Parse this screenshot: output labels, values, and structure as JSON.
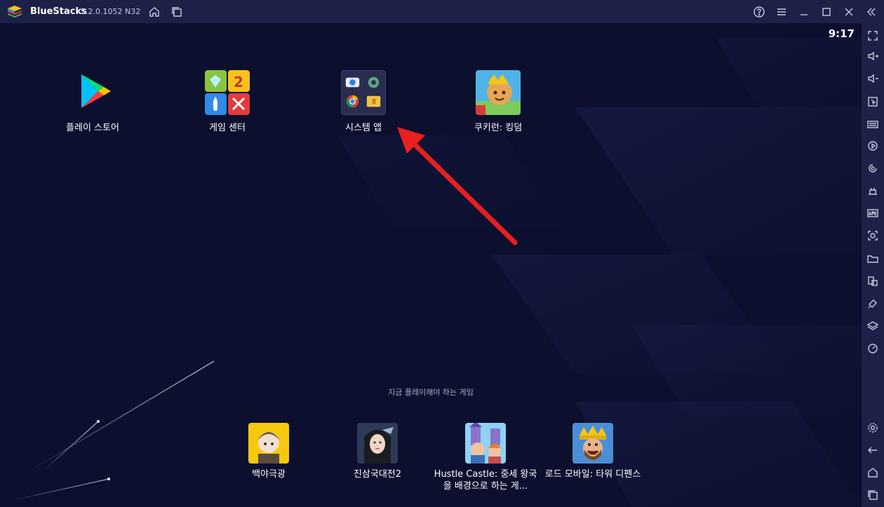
{
  "titlebar": {
    "app_name": "BlueStacks",
    "version": "5.2.0.1052 N32"
  },
  "status": {
    "time": "9:17"
  },
  "home_apps": [
    {
      "label": "플레이 스토어",
      "icon": "play-store-icon"
    },
    {
      "label": "게임 센터",
      "icon": "game-center-icon"
    },
    {
      "label": "시스템 앱",
      "icon": "system-apps-folder-icon"
    },
    {
      "label": "쿠키런: 킹덤",
      "icon": "cookie-run-kingdom-icon"
    }
  ],
  "recommended": {
    "title": "지금 플레이해야 하는 게임",
    "games": [
      {
        "label": "백야극광",
        "icon": "baekyageukgwang-icon"
      },
      {
        "label": "진삼국대전2",
        "icon": "jinsamgukdaejeon2-icon"
      },
      {
        "label": "Hustle Castle: 중세 왕국을 배경으로 하는 게...",
        "icon": "hustle-castle-icon"
      },
      {
        "label": "로드 모바일: 타워 디펜스",
        "icon": "lords-mobile-icon"
      }
    ]
  },
  "colors": {
    "titlebar_bg": "#1e2147",
    "screen_bg": "#0c0f2e",
    "arrow": "#e8201f"
  }
}
